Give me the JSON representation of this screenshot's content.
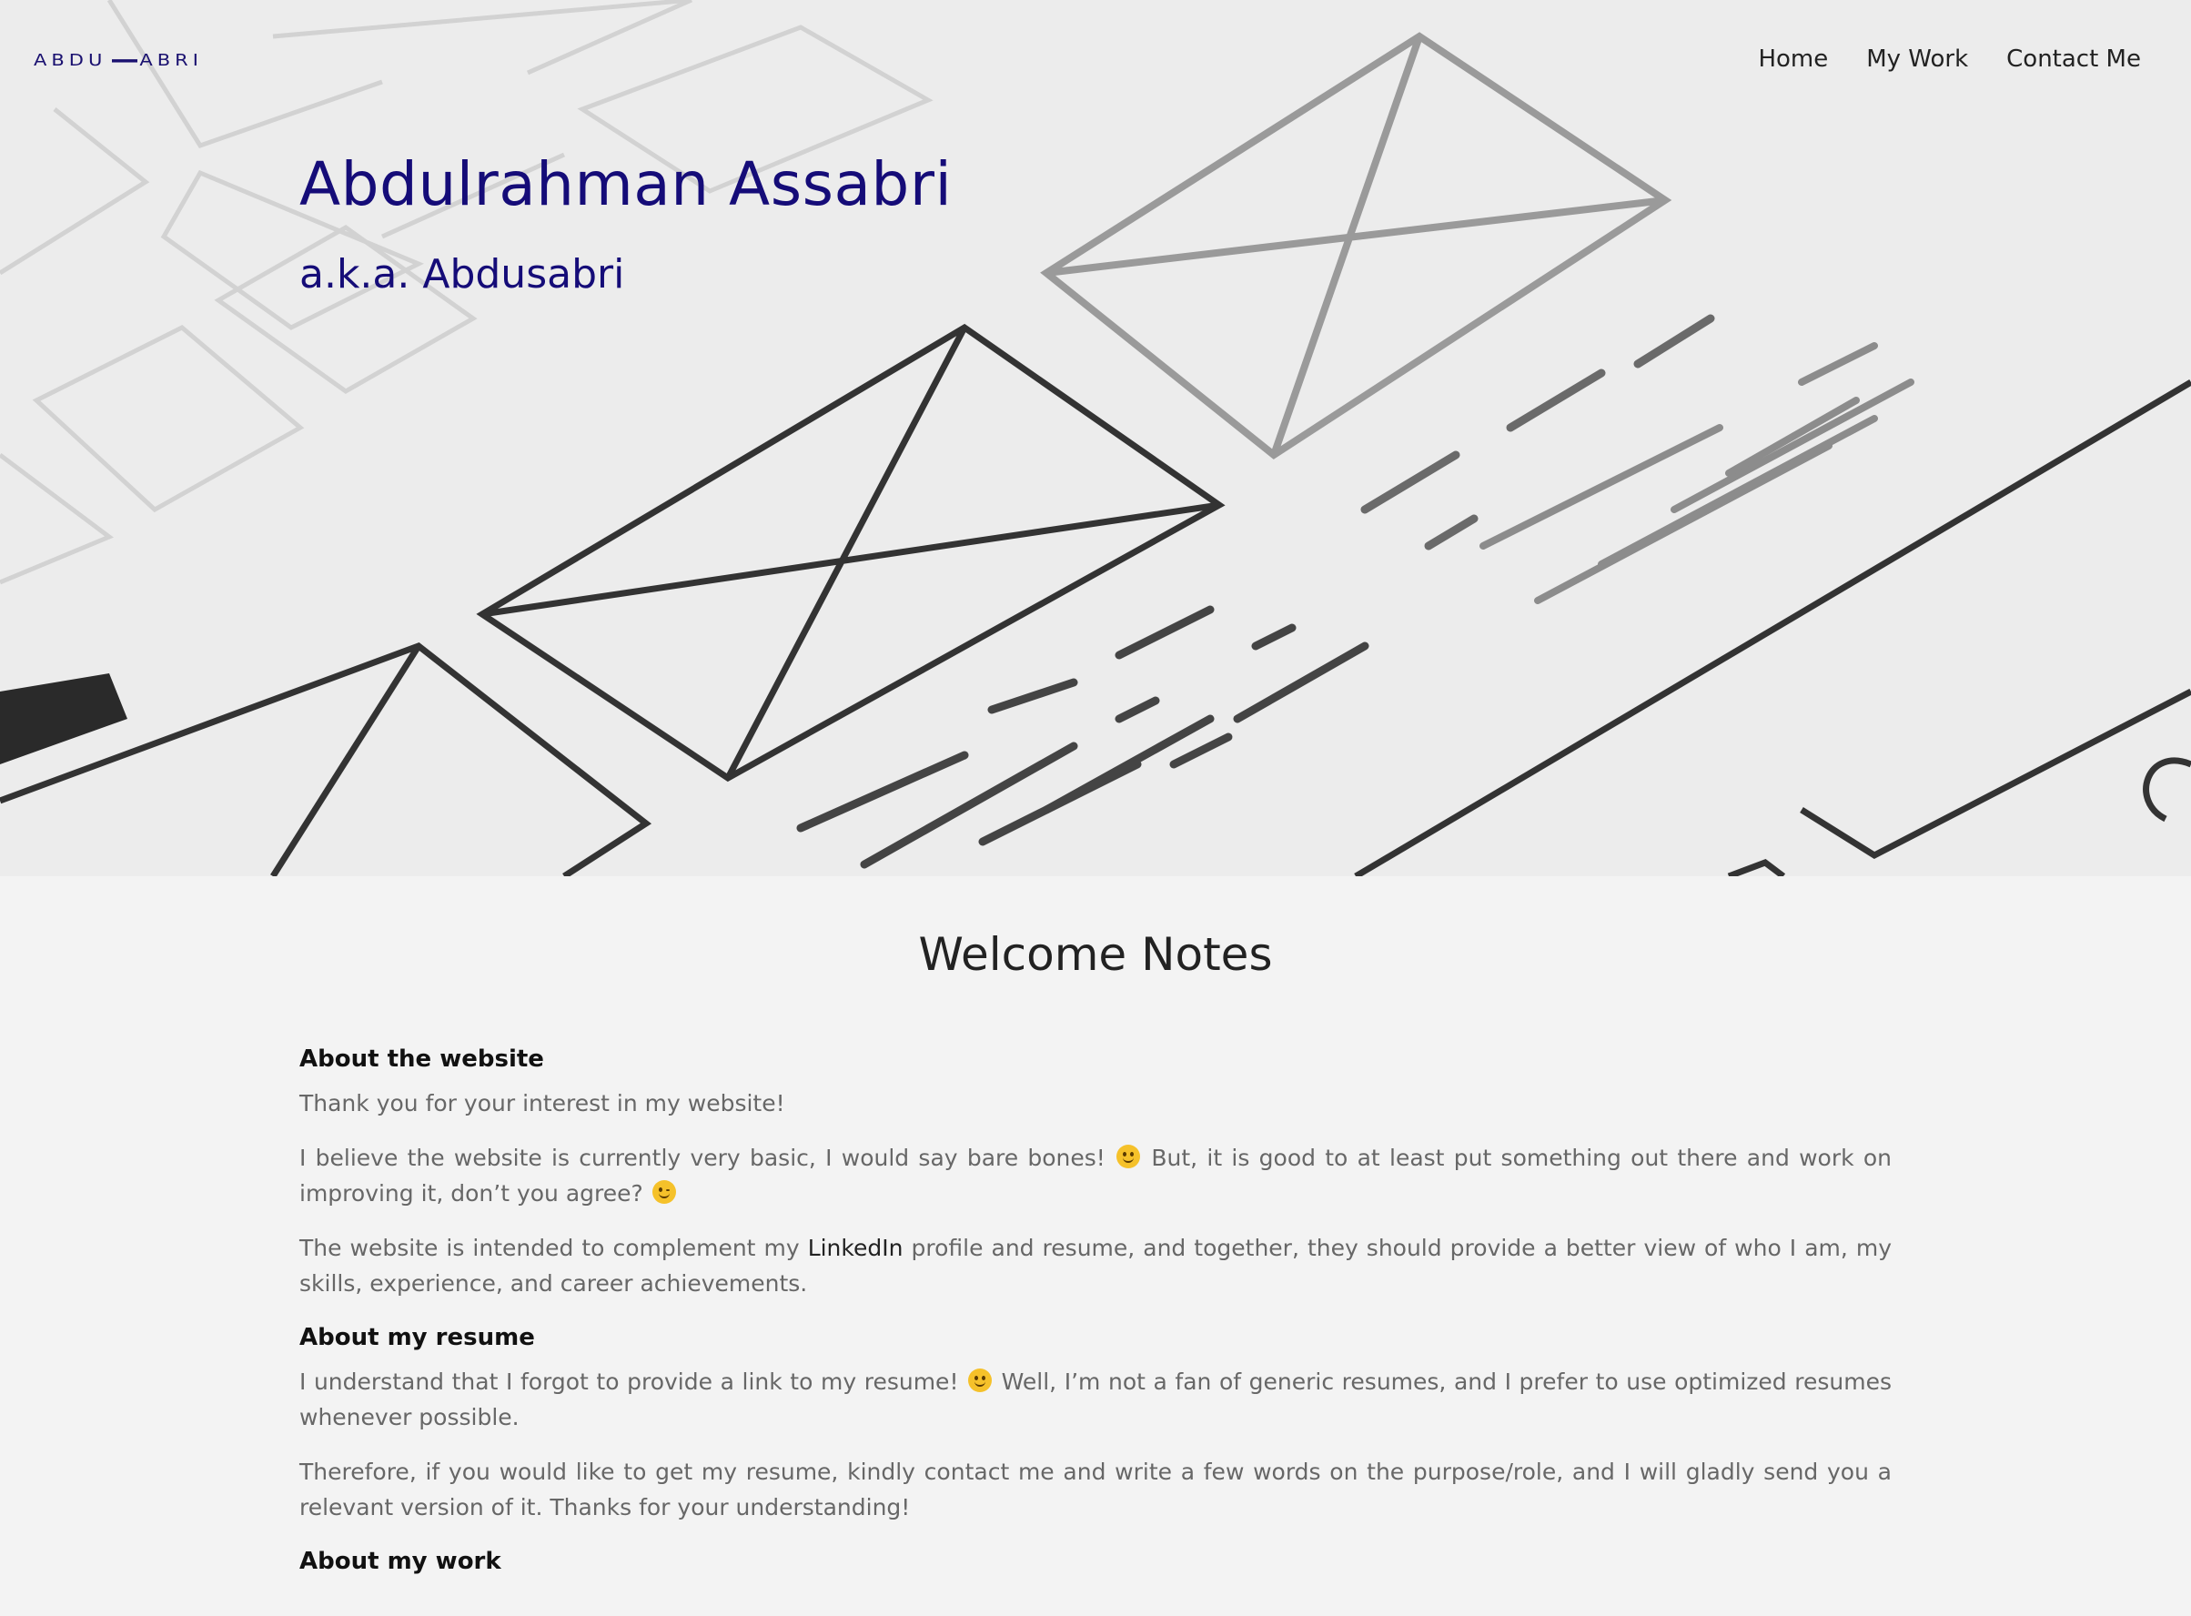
{
  "header": {
    "logo_left": "ABDU",
    "logo_right": "ABRI",
    "nav": [
      {
        "label": "Home"
      },
      {
        "label": "My Work"
      },
      {
        "label": "Contact Me"
      }
    ]
  },
  "hero": {
    "title": "Abdulrahman Assabri",
    "subtitle": "a.k.a. Abdusabri"
  },
  "main": {
    "title": "Welcome Notes",
    "sections": [
      {
        "heading": "About the website",
        "p1": "Thank you for your interest in my website!",
        "p2a": "I believe the website is currently very basic, I would say bare bones! ",
        "p2b": " But, it is good to at least put something out there and work on improving it, don’t you agree? ",
        "p3a": "The website is intended to complement my ",
        "p3link": "LinkedIn",
        "p3b": " profile and resume, and together, they should provide a better view of who I am, my skills, experience, and career achievements."
      },
      {
        "heading": "About my resume",
        "p1a": "I understand that I forgot to provide a link to my resume! ",
        "p1b": " Well, I’m not a fan of generic resumes, and I prefer to use optimized resumes whenever possible.",
        "p2": "Therefore, if you would like to get my resume, kindly contact me and write a few words on the purpose/role, and I will gladly send you a relevant version of it. Thanks for your understanding!"
      },
      {
        "heading": "About my work"
      }
    ]
  },
  "colors": {
    "brand": "#150c78",
    "body_text": "#676767",
    "background": "#f3f3f3"
  },
  "icons": {
    "smile": "slightly-smiling-face-emoji",
    "wink": "winking-face-emoji"
  }
}
